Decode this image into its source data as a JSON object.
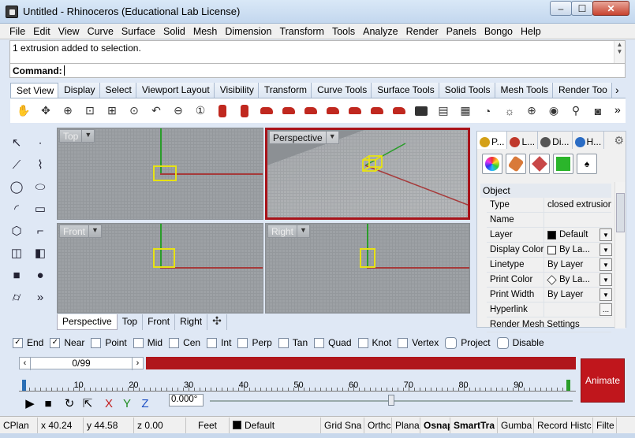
{
  "window": {
    "title": "Untitled - Rhinoceros (Educational Lab License)",
    "min": "–",
    "max": "☐",
    "close": "✕"
  },
  "menu": [
    "File",
    "Edit",
    "View",
    "Curve",
    "Surface",
    "Solid",
    "Mesh",
    "Dimension",
    "Transform",
    "Tools",
    "Analyze",
    "Render",
    "Panels",
    "Bongo",
    "Help"
  ],
  "history": {
    "line": "1 extrusion added to selection."
  },
  "command": {
    "label": "Command:"
  },
  "toolbar_tabs": [
    "Set View",
    "Display",
    "Select",
    "Viewport Layout",
    "Visibility",
    "Transform",
    "Curve Tools",
    "Surface Tools",
    "Solid Tools",
    "Mesh Tools",
    "Render Too"
  ],
  "toolbar_icons": [
    "hand-pan-icon",
    "rotate-view-icon",
    "zoom-icon",
    "zoom-window-icon",
    "zoom-extents-icon",
    "zoom-selected-icon",
    "undo-view-icon",
    "zoom-out-icon",
    "zoom-1to1-icon",
    "car-top-icon",
    "car-bottom-icon",
    "car-left-icon",
    "car-right-icon",
    "car-front-icon",
    "car-back-icon",
    "car-perspective-icon",
    "car-3d-icon",
    "car-two-point-icon",
    "camera-icon",
    "named-view-icon",
    "named-cplane-icon",
    "cplane-icon",
    "light-icon",
    "target-icon",
    "compass-icon",
    "properties-icon",
    "render-camera-icon"
  ],
  "viewports": {
    "top": {
      "label": "Top"
    },
    "perspective": {
      "label": "Perspective"
    },
    "front": {
      "label": "Front"
    },
    "right": {
      "label": "Right"
    }
  },
  "viewport_tabs": [
    "Perspective",
    "Top",
    "Front",
    "Right"
  ],
  "viewport_tab_add": "✣",
  "panel": {
    "tabs": [
      {
        "label": "P...",
        "color": "#d4a017"
      },
      {
        "label": "L...",
        "color": "#c0392b"
      },
      {
        "label": "Di...",
        "color": "#555555"
      },
      {
        "label": "H...",
        "color": "#2a6cc4"
      }
    ],
    "object_header": "Object",
    "properties": [
      {
        "label": "Type",
        "value": "closed extrusion"
      },
      {
        "label": "Name",
        "value": ""
      },
      {
        "label": "Layer",
        "value": "Default",
        "swatch": "#000000",
        "drop": true
      },
      {
        "label": "Display Color",
        "value": "By La...",
        "swatch": "#ffffff",
        "drop": true
      },
      {
        "label": "Linetype",
        "value": "By Layer",
        "drop": true
      },
      {
        "label": "Print Color",
        "value": "By La...",
        "swatch": "diamond",
        "drop": true
      },
      {
        "label": "Print Width",
        "value": "By Layer",
        "drop": true
      },
      {
        "label": "Hyperlink",
        "value": "",
        "more": "..."
      },
      {
        "label": "Render Mesh Settings",
        "value": ""
      }
    ]
  },
  "osnap": [
    {
      "label": "End",
      "checked": true
    },
    {
      "label": "Near",
      "checked": true
    },
    {
      "label": "Point",
      "checked": false
    },
    {
      "label": "Mid",
      "checked": false
    },
    {
      "label": "Cen",
      "checked": false
    },
    {
      "label": "Int",
      "checked": false
    },
    {
      "label": "Perp",
      "checked": false
    },
    {
      "label": "Tan",
      "checked": false
    },
    {
      "label": "Quad",
      "checked": false
    },
    {
      "label": "Knot",
      "checked": false
    },
    {
      "label": "Vertex",
      "checked": false
    },
    {
      "label": "Project",
      "checked": false
    },
    {
      "label": "Disable",
      "checked": false
    }
  ],
  "animation": {
    "frame": "0/99",
    "ticks": [
      "10",
      "20",
      "30",
      "40",
      "50",
      "60",
      "70",
      "80",
      "90"
    ],
    "animate_label": "Animate",
    "angle": "0.000°",
    "slider": 0.5
  },
  "status": {
    "cplane": "CPlan",
    "x": "x 40.24",
    "y": "y 44.58",
    "z": "z 0.00",
    "units": "Feet",
    "layer": "Default",
    "grid": "Grid Sna",
    "ortho": "Orthc",
    "planar": "Plana",
    "osnap": "Osnap",
    "smarttrack": "SmartTra",
    "gumball": "Gumba",
    "record": "Record Histc",
    "filter": "Filte"
  }
}
